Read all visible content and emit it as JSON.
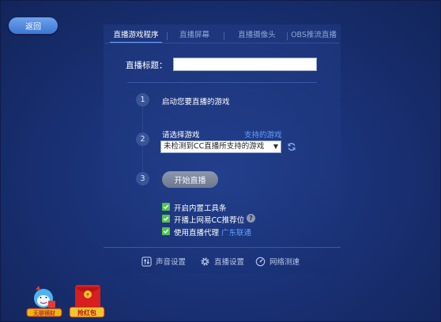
{
  "back": {
    "label": "返回"
  },
  "tabs": [
    {
      "label": "直播游戏程序",
      "active": true
    },
    {
      "label": "直播屏幕",
      "active": false
    },
    {
      "label": "直播摄像头",
      "active": false
    },
    {
      "label": "OBS推流直播",
      "active": false
    }
  ],
  "title_field": {
    "label": "直播标题：",
    "value": ""
  },
  "steps": [
    {
      "number": "1",
      "text": "启动您要直播的游戏"
    },
    {
      "number": "2",
      "text": "请选择游戏",
      "link": "支持的游戏",
      "select_value": "未检测到CC直播所支持的游戏"
    },
    {
      "number": "3",
      "button": "开始直播"
    }
  ],
  "options": [
    {
      "label": "开启内置工具条",
      "checked": true
    },
    {
      "label": "开播上网易CC推荐位",
      "checked": true
    },
    {
      "label": "使用直播代理",
      "checked": true,
      "link": "广东联通"
    }
  ],
  "footer": {
    "sound": "声音设置",
    "live": "直播设置",
    "network": "网络测速"
  },
  "promos": {
    "left_badge": "无聊横财",
    "right_badge": "抢红包"
  },
  "colors": {
    "background": "#1a3277",
    "accent": "#5fa0ff",
    "check": "#54c24f",
    "back_button": "#4f88e0"
  }
}
